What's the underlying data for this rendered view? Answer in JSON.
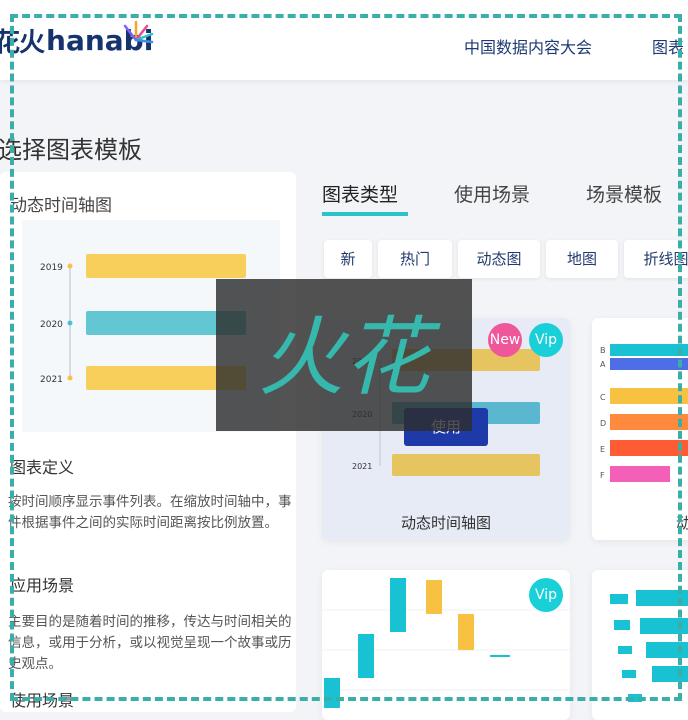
{
  "header": {
    "logo_cn": "花火",
    "logo_en": "hanabi",
    "nav": [
      "中国数据内容大会",
      "图表"
    ]
  },
  "page_title": "选择图表模板",
  "detail": {
    "title": "动态时间轴图",
    "preview_years": [
      "2019",
      "2020",
      "2021"
    ],
    "definition_heading": "图表定义",
    "definition_text": "按时间顺序显示事件列表。在缩放时间轴中，事件根据事件之间的实际时间距离按比例放置。",
    "scenario_heading": "应用场景",
    "scenario_text": "主要目的是随着时间的推移，传达与时间相关的信息，或用于分析，或以视觉呈现一个故事或历史观点。",
    "cut_heading": "使用场景"
  },
  "tabs": [
    "图表类型",
    "使用场景",
    "场景模板"
  ],
  "filters": [
    "新",
    "热门",
    "动态图",
    "地图",
    "折线图"
  ],
  "cards": [
    {
      "caption": "动态时间轴图",
      "badges": [
        "New",
        "Vip"
      ],
      "use_label": "使用"
    },
    {
      "caption": "动",
      "labels": [
        "B",
        "A",
        "C",
        "D",
        "E",
        "F"
      ]
    },
    {
      "badges": [
        "Vip"
      ]
    },
    {}
  ],
  "watermark_text": "火花",
  "colors": {
    "accent": "#2ac3c9",
    "brand": "#16336e",
    "use_button": "#1e3aa8",
    "new_badge": "#f0569a",
    "vip_badge": "#19d0d8",
    "frame": "#3aafa9"
  }
}
